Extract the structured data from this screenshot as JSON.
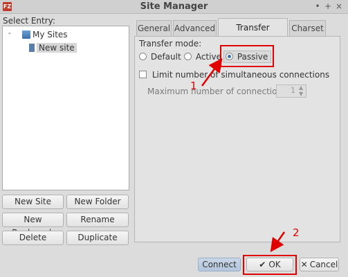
{
  "window": {
    "title": "Site Manager",
    "app_icon": "FZ",
    "minimize": "•",
    "maximize": "+",
    "close": "×"
  },
  "left": {
    "select_entry_label": "Select Entry:",
    "tree": {
      "root_toggle": "-",
      "root_label": "My Sites",
      "child_label": "New site"
    },
    "buttons": {
      "new_site": "New Site",
      "new_folder": "New Folder",
      "new_bookmark": "New Bookmark",
      "rename": "Rename",
      "delete": "Delete",
      "duplicate": "Duplicate"
    }
  },
  "tabs": [
    "General",
    "Advanced",
    "Transfer Settings",
    "Charset"
  ],
  "active_tab": "Transfer Settings",
  "transfer": {
    "mode_label": "Transfer mode:",
    "options": [
      "Default",
      "Active",
      "Passive"
    ],
    "selected": "Passive",
    "limit_label": "Limit number of simultaneous connections",
    "limit_checked": false,
    "max_label": "Maximum number of connections:",
    "max_value": "1"
  },
  "footer": {
    "connect": "Connect",
    "ok": "OK",
    "cancel": "Cancel"
  },
  "annotations": {
    "step1": "1",
    "step2": "2",
    "color": "#e00000"
  }
}
